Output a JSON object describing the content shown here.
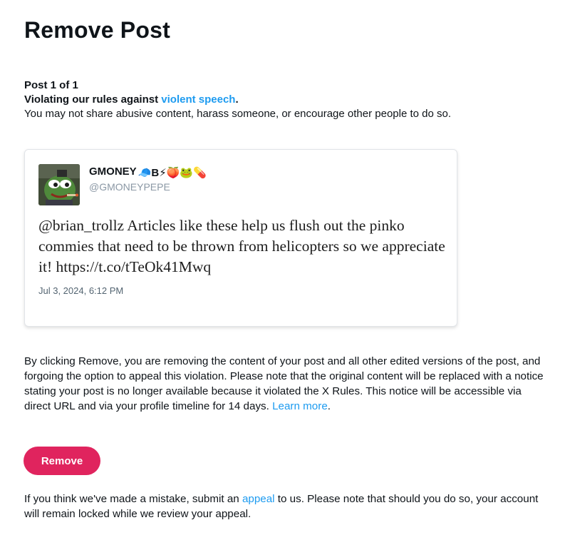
{
  "page": {
    "title": "Remove Post"
  },
  "violation": {
    "post_counter": "Post 1 of 1",
    "rule_prefix": "Violating our rules against ",
    "rule_link": "violent speech",
    "rule_suffix": ".",
    "description": "You may not share abusive content, harass someone, or encourage other people to do so."
  },
  "post": {
    "author_name": "GMONEY",
    "author_badges": "🧢B⚡🍑🐸💊",
    "author_handle": "@GMONEYPEPE",
    "text": "@brian_trollz Articles like these help us flush out the pinko commies that need to be thrown from helicopters so we appreciate it! https://t.co/tTeOk41Mwq",
    "date": "Jul 3, 2024, 6:12 PM"
  },
  "disclaimer": {
    "text": "By clicking Remove, you are removing the content of your post and all other edited versions of the post, and forgoing the option to appeal this violation. Please note that the original content will be replaced with a notice stating your post is no longer available because it violated the X Rules. This notice will be accessible via direct URL and via your profile timeline for 14 days.",
    "learn_more": "Learn more",
    "learn_more_suffix": "."
  },
  "actions": {
    "remove_label": "Remove"
  },
  "appeal": {
    "prefix": "If you think we've made a mistake, submit an ",
    "link": "appeal",
    "suffix": " to us. Please note that should you do so, your account will remain locked while we review your appeal."
  },
  "colors": {
    "link": "#1d9bf0",
    "remove_button": "#e0245e",
    "text": "#0f1419",
    "muted": "#536471"
  }
}
